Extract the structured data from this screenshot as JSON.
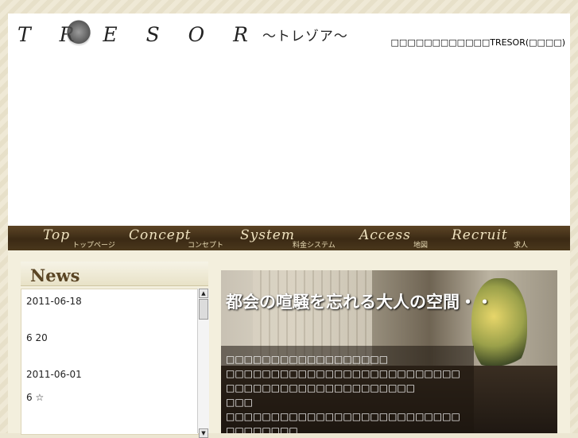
{
  "header": {
    "logo_text": "T R E S O R",
    "logo_sub": "〜トレゾア〜",
    "tagline": "□□□□□□□□□□□□TRESOR(□□□□)"
  },
  "nav": {
    "items": [
      {
        "en": "Top",
        "jp": "トップページ"
      },
      {
        "en": "Concept",
        "jp": "コンセプト"
      },
      {
        "en": "System",
        "jp": "料金システム"
      },
      {
        "en": "Access",
        "jp": "地図"
      },
      {
        "en": "Recruit",
        "jp": "求人"
      }
    ]
  },
  "news": {
    "title": "News",
    "items": [
      {
        "text": "2011-06-18"
      },
      {
        "text": "6 20"
      },
      {
        "text": "2011-06-01"
      },
      {
        "text": "6       ☆"
      }
    ]
  },
  "hero": {
    "headline": "都会の喧騒を忘れる大人の空間・・",
    "lines": [
      "□□□□□□□□□□□□□□□□□□",
      "□□□□□□□□□□□□□□□□□□□□□□□□□□□□□□□□□□□□□□□□□□□□□□□",
      "□□□",
      "□□□□□□□□□□□□□□□□□□□□□□□□□□□□□□□□□□",
      "□□□□□□□□□□□□□□□□"
    ]
  },
  "colors": {
    "nav_bg": "#4a371c",
    "nav_text": "#efe2bf",
    "news_title": "#5a4524",
    "page_bg": "#ece6d2"
  }
}
